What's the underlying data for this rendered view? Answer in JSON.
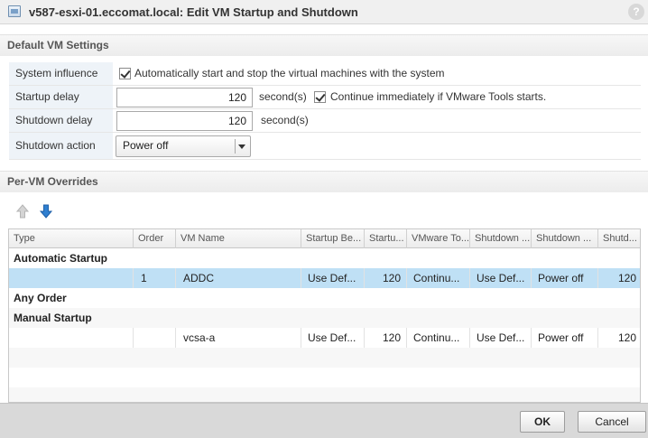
{
  "window": {
    "title": "v587-esxi-01.eccomat.local: Edit VM Startup and Shutdown",
    "help_label": "?"
  },
  "default_settings": {
    "header": "Default VM Settings",
    "system_influence": {
      "label": "System influence",
      "checked": true,
      "text": "Automatically start and stop the virtual machines with the system"
    },
    "startup_delay": {
      "label": "Startup delay",
      "value": "120",
      "unit": "second(s)",
      "continue_checked": true,
      "continue_text": "Continue immediately if VMware Tools starts."
    },
    "shutdown_delay": {
      "label": "Shutdown delay",
      "value": "120",
      "unit": "second(s)"
    },
    "shutdown_action": {
      "label": "Shutdown action",
      "value": "Power off"
    }
  },
  "overrides": {
    "header": "Per-VM Overrides",
    "columns": [
      "Type",
      "Order",
      "VM Name",
      "Startup Be...",
      "Startu...",
      "VMware To...",
      "Shutdown ...",
      "Shutdown ...",
      "Shutd..."
    ],
    "groups": {
      "automatic": "Automatic Startup",
      "any": "Any Order",
      "manual": "Manual Startup"
    },
    "rows": [
      {
        "order": "1",
        "vm_name": "ADDC",
        "startup_behavior": "Use Def...",
        "startup_delay": "120",
        "vmware_tools": "Continu...",
        "shutdown_behavior": "Use Def...",
        "shutdown_action": "Power off",
        "shutdown_delay": "120"
      },
      {
        "order": "",
        "vm_name": "vcsa-a",
        "startup_behavior": "Use Def...",
        "startup_delay": "120",
        "vmware_tools": "Continu...",
        "shutdown_behavior": "Use Def...",
        "shutdown_action": "Power off",
        "shutdown_delay": "120"
      }
    ]
  },
  "buttons": {
    "ok": "OK",
    "cancel": "Cancel"
  },
  "icons": {
    "move_up": "arrow-up-icon",
    "move_down": "arrow-down-icon"
  },
  "colors": {
    "selected_row": "#bfe0f5",
    "label_bg": "#eef3f8",
    "move_down_arrow": "#2f7fd0"
  }
}
